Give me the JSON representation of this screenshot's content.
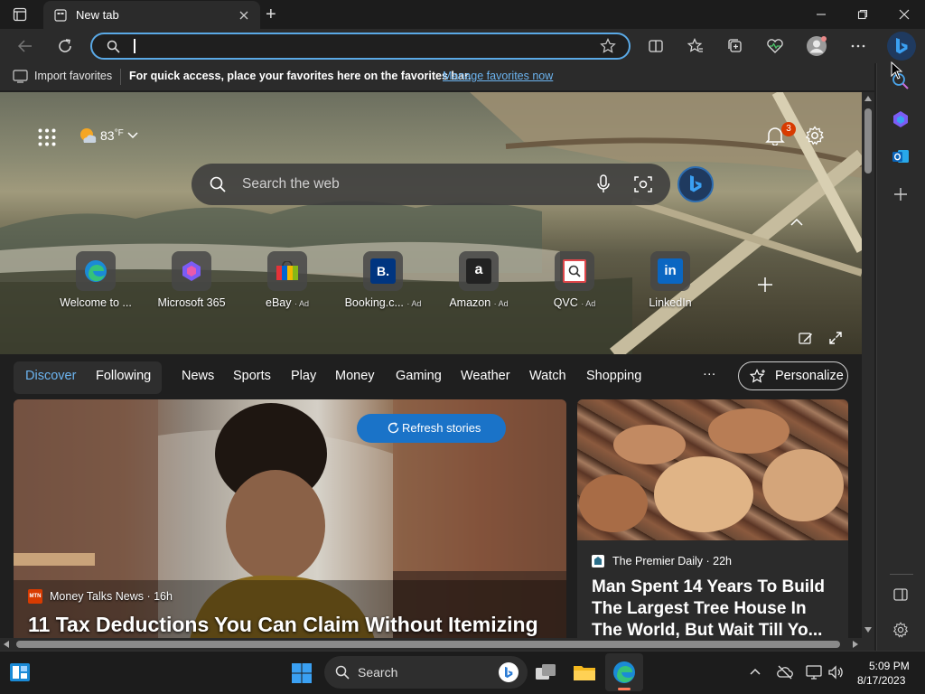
{
  "window": {
    "tab_title": "New tab",
    "new_tab_symbol": "+"
  },
  "toolbar": {
    "address_value": ""
  },
  "favorites_bar": {
    "import_label": "Import favorites",
    "message": "For quick access, place your favorites here on the favorites bar.",
    "manage_link": "Manage favorites now"
  },
  "newtab": {
    "weather_temp": "83",
    "weather_unit": "°F",
    "notification_count": "3",
    "search_placeholder": "Search the web",
    "quick_links": [
      {
        "label": "Welcome to ...",
        "ad": ""
      },
      {
        "label": "Microsoft 365",
        "ad": ""
      },
      {
        "label": "eBay",
        "ad": "· Ad"
      },
      {
        "label": "Booking.c...",
        "ad": "· Ad"
      },
      {
        "label": "Amazon",
        "ad": "· Ad"
      },
      {
        "label": "QVC",
        "ad": "· Ad"
      },
      {
        "label": "LinkedIn",
        "ad": ""
      }
    ]
  },
  "feed": {
    "pill_tabs": [
      "Discover",
      "Following"
    ],
    "tabs": [
      "News",
      "Sports",
      "Play",
      "Money",
      "Gaming",
      "Weather",
      "Watch",
      "Shopping"
    ],
    "more": "···",
    "personalize": "Personalize",
    "refresh": "Refresh stories",
    "main_card": {
      "source_badge": "MTN",
      "source": "Money Talks News · 16h",
      "headline": "11 Tax Deductions You Can Claim Without Itemizing"
    },
    "side_card": {
      "source": "The Premier Daily · 22h",
      "headline": "Man Spent 14 Years To Build The Largest Tree House In The World, But Wait Till Yo..."
    }
  },
  "taskbar": {
    "search_label": "Search",
    "time": "5:09 PM",
    "date": "8/17/2023"
  },
  "colors": {
    "accent": "#5aa9e6",
    "link": "#6cb4f0",
    "refresh_button": "#1a73c8",
    "badge": "#d83b01"
  }
}
